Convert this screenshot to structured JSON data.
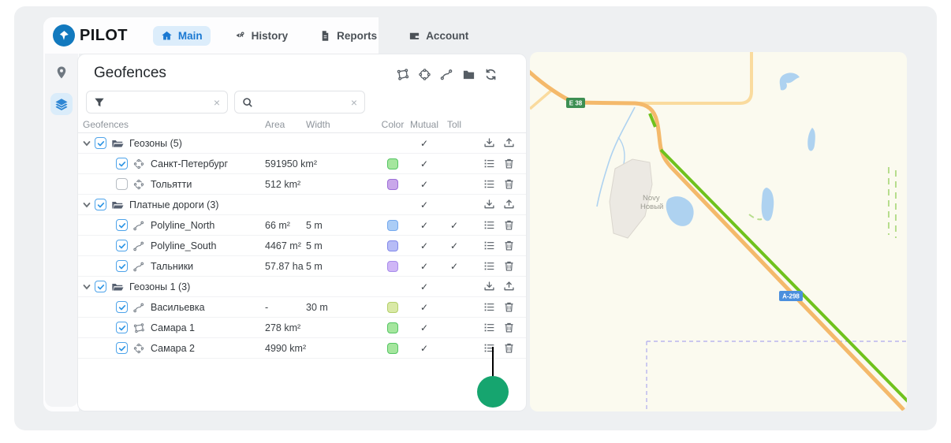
{
  "brand": {
    "name": "PILOT"
  },
  "nav": {
    "active_color": "#1b79d2",
    "items": [
      {
        "label": "Main",
        "icon": "home",
        "active": true
      },
      {
        "label": "History",
        "icon": "history",
        "active": false
      },
      {
        "label": "Reports",
        "icon": "reports",
        "active": false
      },
      {
        "label": "Account",
        "icon": "account",
        "active": false
      }
    ]
  },
  "sidebar": {
    "items": [
      {
        "icon": "pin",
        "active": false
      },
      {
        "icon": "layers",
        "active": true
      }
    ]
  },
  "panel": {
    "title": "Geofences",
    "toolbar": [
      {
        "icon": "polygon-tool"
      },
      {
        "icon": "circle-tool"
      },
      {
        "icon": "polyline-tool"
      },
      {
        "icon": "folder-tool"
      },
      {
        "icon": "refresh"
      }
    ],
    "filter": {
      "value": "",
      "clear_label": "×"
    },
    "search": {
      "value": "",
      "clear_label": "×"
    },
    "table": {
      "headers": [
        "Geofences",
        "Area",
        "Width",
        "Color",
        "Mutual",
        "Toll"
      ],
      "check_glyph": "✓",
      "color_palette": {
        "green": {
          "fill": "#a5e69e",
          "border": "#55c564"
        },
        "purple": {
          "fill": "#c9a7ea",
          "border": "#9d6fd8"
        },
        "blue": {
          "fill": "#abcdf6",
          "border": "#74a9ee"
        },
        "indigo": {
          "fill": "#b7bcf6",
          "border": "#8289ea"
        },
        "violet": {
          "fill": "#cfb6f6",
          "border": "#a78ceb"
        },
        "lime": {
          "fill": "#d9e9a6",
          "border": "#b3cf6a"
        }
      },
      "rows": [
        {
          "kind": "folder",
          "label": "Геозоны (5)",
          "checked": true,
          "area": "",
          "width": "",
          "color": null,
          "mutual": true,
          "toll": false
        },
        {
          "kind": "item",
          "icon": "circle",
          "label": "Санкт-Петербург",
          "checked": true,
          "area": "591950 km²",
          "width": "",
          "color": "green",
          "mutual": true,
          "toll": false
        },
        {
          "kind": "item",
          "icon": "circle",
          "label": "Тольятти",
          "checked": false,
          "area": "512 km²",
          "width": "",
          "color": "purple",
          "mutual": true,
          "toll": false
        },
        {
          "kind": "folder",
          "label": "Платные дороги (3)",
          "checked": true,
          "area": "",
          "width": "",
          "color": null,
          "mutual": true,
          "toll": false
        },
        {
          "kind": "item",
          "icon": "polyline",
          "label": "Polyline_North",
          "checked": true,
          "area": "66 m²",
          "width": "5 m",
          "color": "blue",
          "mutual": true,
          "toll": true
        },
        {
          "kind": "item",
          "icon": "polyline",
          "label": "Polyline_South",
          "checked": true,
          "area": "4467 m²",
          "width": "5 m",
          "color": "indigo",
          "mutual": true,
          "toll": true
        },
        {
          "kind": "item",
          "icon": "polyline",
          "label": "Тальники",
          "checked": true,
          "area": "57.87 ha",
          "width": "5 m",
          "color": "violet",
          "mutual": true,
          "toll": true
        },
        {
          "kind": "folder",
          "label": "Геозоны 1 (3)",
          "checked": true,
          "area": "",
          "width": "",
          "color": null,
          "mutual": true,
          "toll": false
        },
        {
          "kind": "item",
          "icon": "polyline",
          "label": "Васильевка",
          "checked": true,
          "area": "-",
          "width": "30 m",
          "color": "lime",
          "mutual": true,
          "toll": false
        },
        {
          "kind": "item",
          "icon": "polygon",
          "label": "Самара 1",
          "checked": true,
          "area": "278 km²",
          "width": "",
          "color": "green",
          "mutual": true,
          "toll": false
        },
        {
          "kind": "item",
          "icon": "circle",
          "label": "Самара 2",
          "checked": true,
          "area": "4990 km²",
          "width": "",
          "color": "green",
          "mutual": true,
          "toll": false
        }
      ]
    }
  },
  "map": {
    "badges": {
      "e38": "E 38",
      "a298": "A-298"
    },
    "settlement": {
      "name_en": "Novy",
      "name_ru": "Новый"
    },
    "colors": {
      "background": "#fbfaef",
      "main_road": "#f4b96b",
      "minor_road": "#fadb9e",
      "geofence_line": "#6fc21d",
      "water": "#aed2f0",
      "boundary_dash": "#b9b6ee",
      "e38_badge": "#3d8f53",
      "a298_badge": "#4b8fdd"
    }
  },
  "annotation": {
    "dot_color": "#16a56f"
  }
}
